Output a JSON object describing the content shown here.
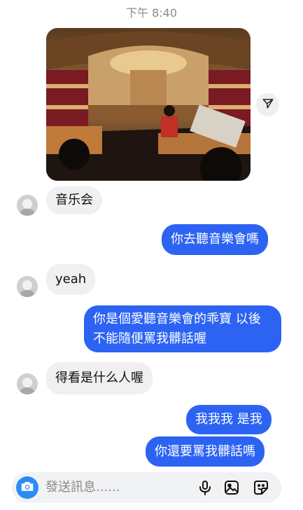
{
  "status": {
    "time": "下午 8:40"
  },
  "messages": {
    "m1": "音乐会",
    "m2": "你去聽音樂會嗎",
    "m3": "yeah",
    "m4": "你是個愛聽音樂會的乖寶 以後不能隨便罵我髒話喔",
    "m5": "得看是什么人喔",
    "m6": "我我我 是我",
    "m7": "你還要罵我髒話嗎"
  },
  "composer": {
    "placeholder": "發送訊息......"
  },
  "icons": {
    "share": "send-icon",
    "camera": "camera-icon",
    "mic": "mic-icon",
    "gallery": "gallery-icon",
    "sticker": "sticker-icon"
  },
  "colors": {
    "outgoing": "#2c63f3",
    "incoming": "#f0f0f0",
    "camera": "#2c8cf3"
  }
}
